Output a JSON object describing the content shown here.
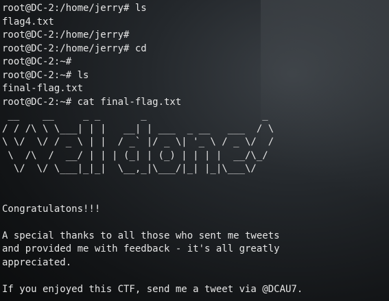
{
  "terminal": {
    "lines": [
      "root@DC-2:/home/jerry# ls",
      "flag4.txt",
      "root@DC-2:/home/jerry#",
      "root@DC-2:/home/jerry# cd",
      "root@DC-2:~#",
      "root@DC-2:~# ls",
      "final-flag.txt",
      "root@DC-2:~# cat final-flag.txt",
      " __    __     _ _       _                    _ ",
      "/ / /\\ \\ \\___| | |   __| | ___  _ __   ___  / \\",
      "\\ \\/  \\/ / _ \\ | |  / _` |/ _ \\| '_ \\ / _ \\/  /",
      " \\  /\\  /  __/ | | | (_| | (_) | | | |  __/\\_/ ",
      "  \\/  \\/ \\___|_|_|  \\__,_|\\___/|_| |_|\\___\\/   ",
      "",
      "",
      "Congratulatons!!!",
      "",
      "A special thanks to all those who sent me tweets",
      "and provided me with feedback - it's all greatly",
      "appreciated.",
      "",
      "If you enjoyed this CTF, send me a tweet via @DCAU7."
    ]
  }
}
